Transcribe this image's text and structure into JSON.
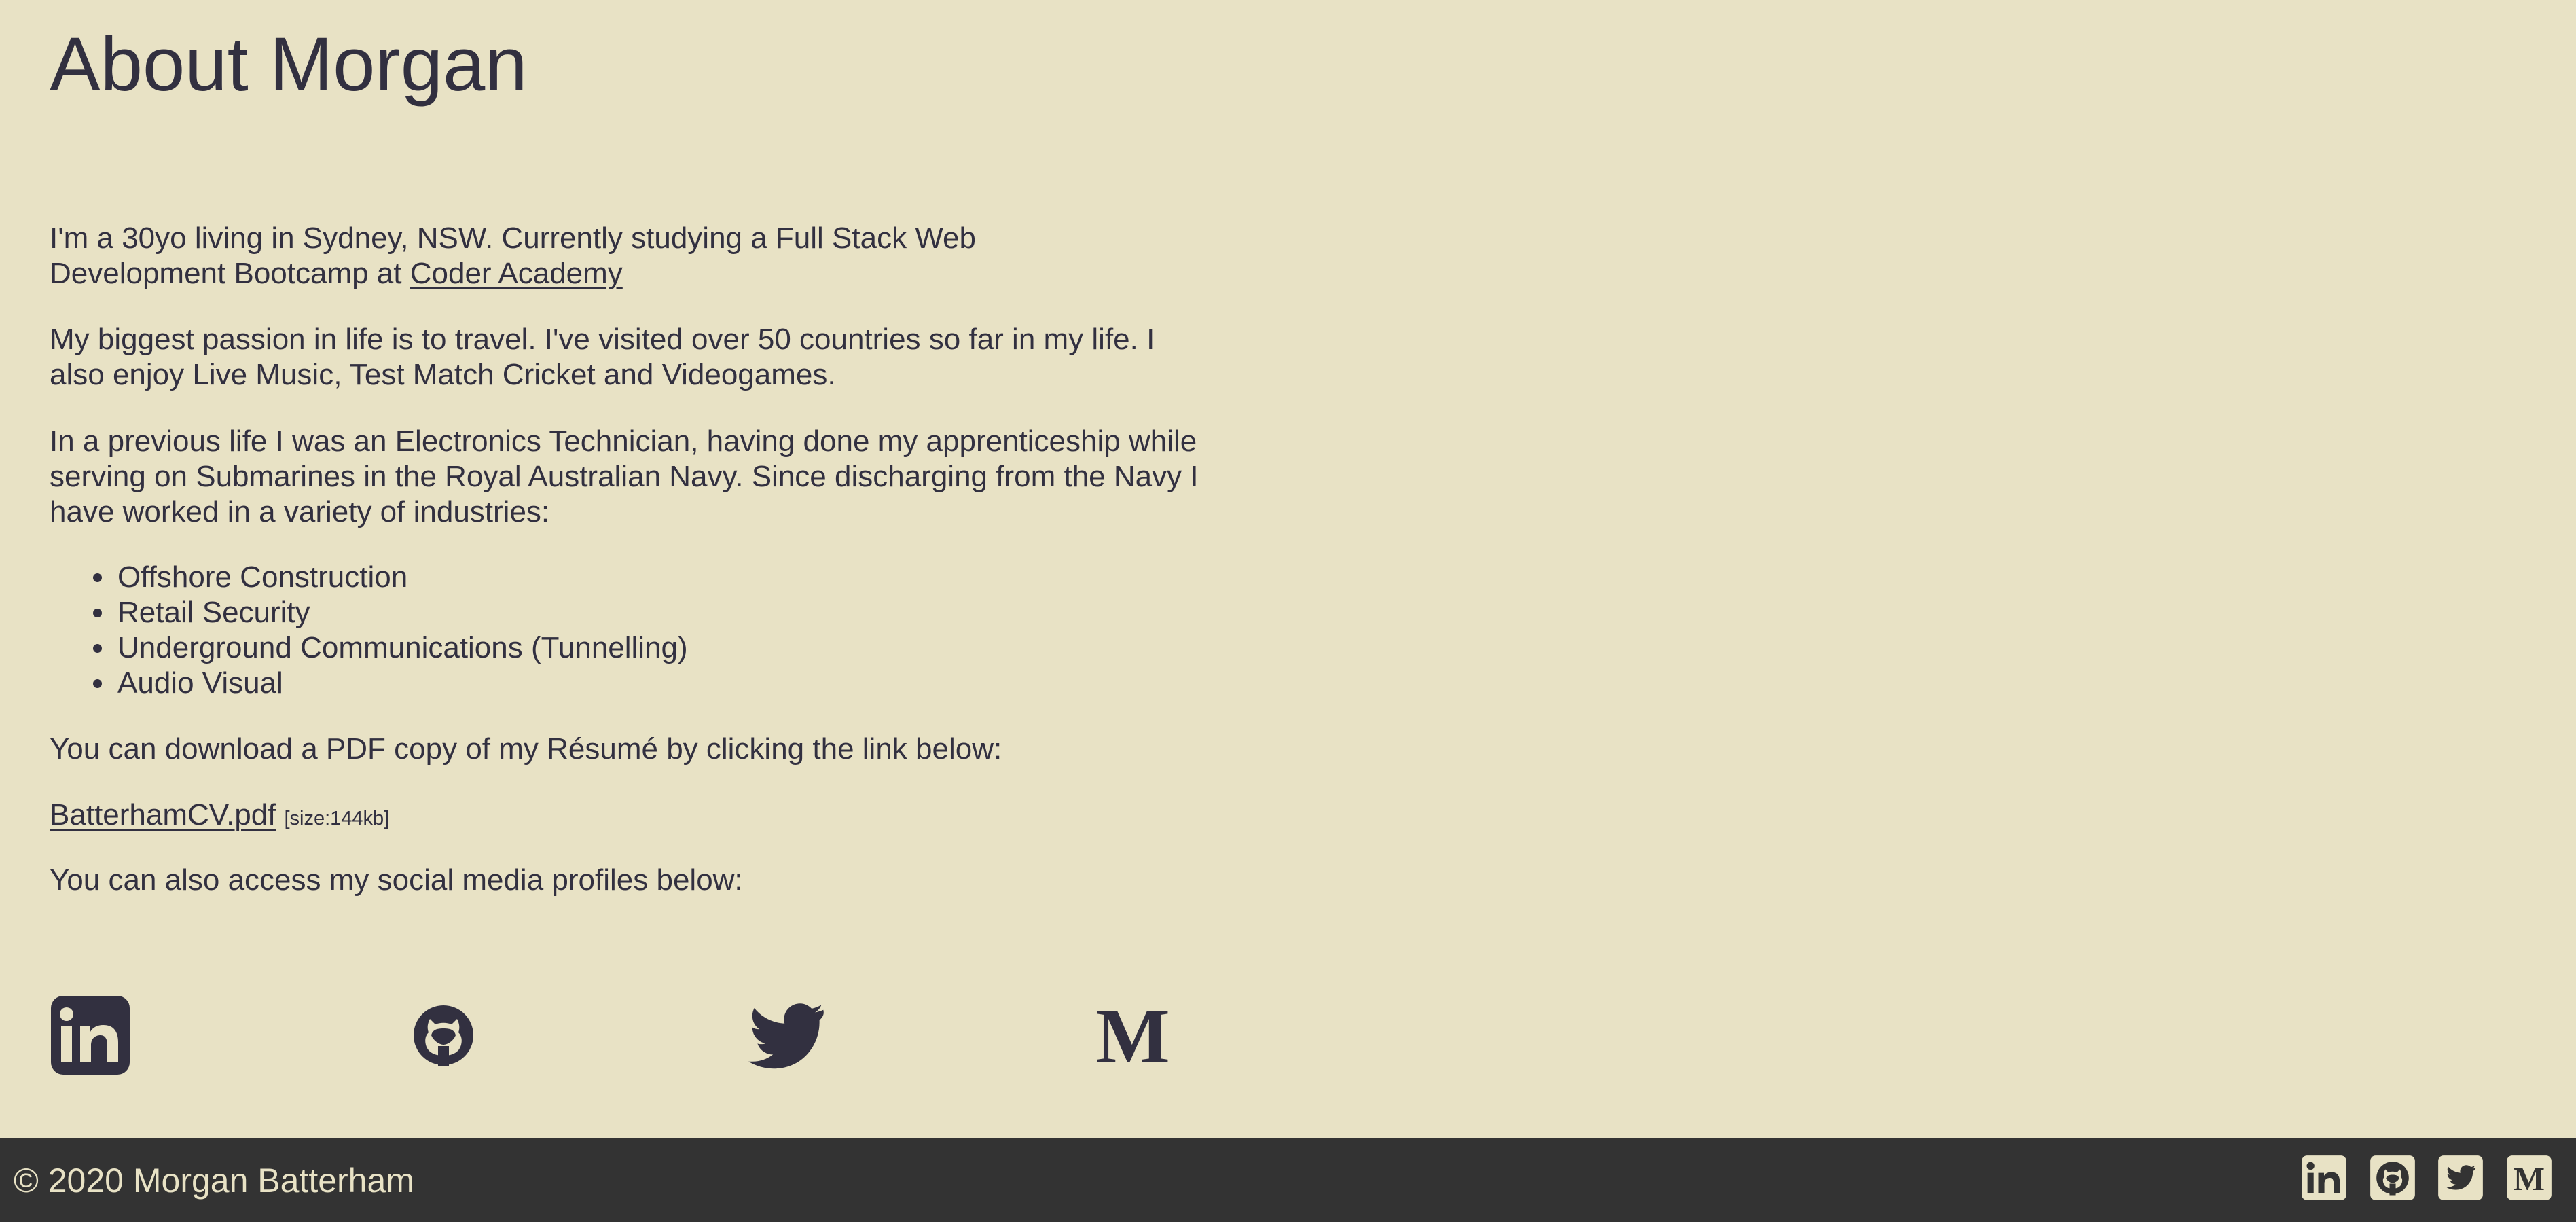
{
  "page": {
    "title": "About Morgan"
  },
  "about": {
    "intro_text": "I'm a 30yo living in Sydney, NSW. Currently studying a Full Stack Web Development Bootcamp at ",
    "intro_link": "Coder Academy",
    "passion_text": "My biggest passion in life is to travel. I've visited over 50 countries so far in my life. I also enjoy Live Music, Test Match Cricket and Videogames.",
    "previous_text": "In a previous life I was an Electronics Technician, having done my apprenticeship while serving on Submarines in the Royal Australian Navy. Since discharging from the Navy I have worked in a variety of industries:",
    "industries": [
      "Offshore Construction",
      "Retail Security",
      "Underground Communications (Tunnelling)",
      "Audio Visual"
    ],
    "download_text": "You can download a PDF copy of my Résumé by clicking the link below:",
    "cv_link": "BatterhamCV.pdf",
    "cv_size": "[size:144kb]",
    "social_text": "You can also access my social media profiles below:"
  },
  "social_icons": [
    "linkedin-icon",
    "github-icon",
    "twitter-icon",
    "medium-icon"
  ],
  "footer": {
    "copyright": "© 2020 Morgan Batterham"
  },
  "colors": {
    "background": "#e8e2c5",
    "text": "#323040",
    "footer_background": "#333333",
    "footer_text": "#e8e2c5"
  }
}
